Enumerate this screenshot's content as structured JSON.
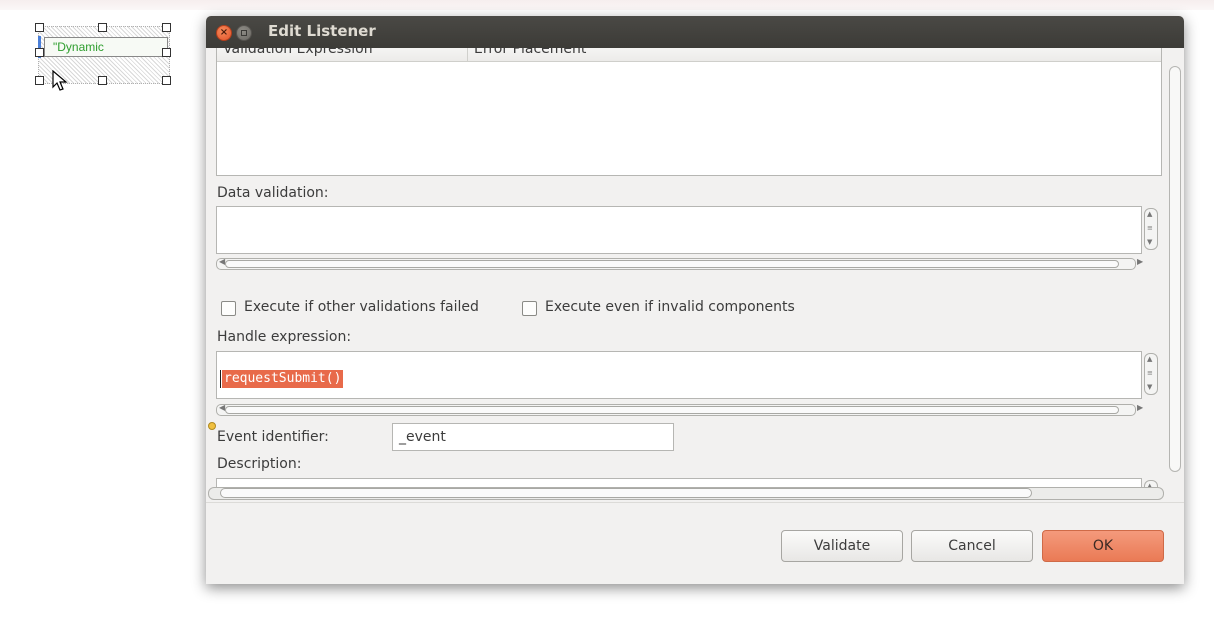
{
  "canvas": {
    "widget_label": "\"Dynamic"
  },
  "dialog": {
    "title": "Edit Listener",
    "close_glyph": "×",
    "validators_table": {
      "columns": [
        "Validation Expression",
        "Error Placement"
      ]
    },
    "data_validation_label": "Data validation:",
    "data_validation_value": "",
    "execute_if_failed": {
      "label": "Execute if other validations failed",
      "checked": false
    },
    "execute_if_invalid": {
      "label": "Execute even if invalid components",
      "checked": false
    },
    "handle_expression_label": "Handle expression:",
    "handle_expression_value": "requestSubmit()",
    "event_identifier_label": "Event identifier:",
    "event_identifier_value": "_event",
    "description_label": "Description:",
    "description_value": "",
    "buttons": {
      "validate": "Validate",
      "cancel": "Cancel",
      "ok": "OK"
    }
  },
  "colors": {
    "ok_button": "#ea7a55",
    "selection": "#e86a4a",
    "titlebar": "#3c3b37",
    "widget_text": "#2e9e2e"
  }
}
